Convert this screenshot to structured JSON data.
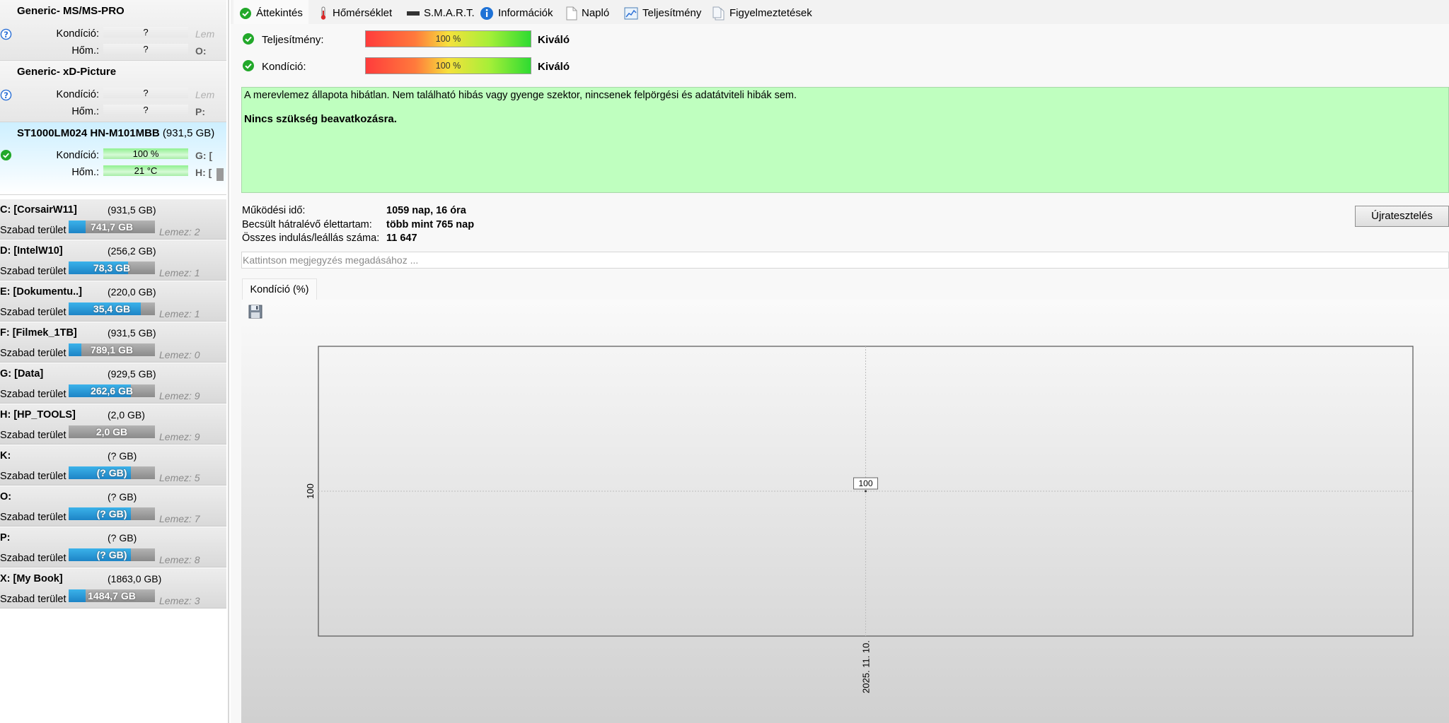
{
  "disks": [
    {
      "name": "Generic- MS/MS-PRO",
      "size": "",
      "kondicio_label": "Kondíció:",
      "kondicio": "?",
      "hom_label": "Hőm.:",
      "hom": "?",
      "side1": "Lem",
      "side2": "O:"
    },
    {
      "name": "Generic- xD-Picture",
      "size": "",
      "kondicio_label": "Kondíció:",
      "kondicio": "?",
      "hom_label": "Hőm.:",
      "hom": "?",
      "side1": "Lem",
      "side2": "P:"
    },
    {
      "name": "ST1000LM024 HN-M101MBB",
      "size": "(931,5 GB)",
      "kondicio_label": "Kondíció:",
      "kondicio": "100 %",
      "hom_label": "Hőm.:",
      "hom": "21 °C",
      "side1": "G: [",
      "side2": "H: ["
    }
  ],
  "partitions": [
    {
      "name": "C: [CorsairW11]",
      "size": "(931,5 GB)",
      "free_label": "Szabad terület",
      "free": "741,7 GB",
      "used_fraction": 0.2,
      "lemez": "Lemez: 2"
    },
    {
      "name": "D: [IntelW10]",
      "size": "(256,2 GB)",
      "free_label": "Szabad terület",
      "free": "78,3 GB",
      "used_fraction": 0.69,
      "lemez": "Lemez: 1"
    },
    {
      "name": "E: [Dokumentu..]",
      "size": "(220,0 GB)",
      "free_label": "Szabad terület",
      "free": "35,4 GB",
      "used_fraction": 0.84,
      "lemez": "Lemez: 1"
    },
    {
      "name": "F: [Filmek_1TB]",
      "size": "(931,5 GB)",
      "free_label": "Szabad terület",
      "free": "789,1 GB",
      "used_fraction": 0.15,
      "lemez": "Lemez: 0"
    },
    {
      "name": "G: [Data]",
      "size": "(929,5 GB)",
      "free_label": "Szabad terület",
      "free": "262,6 GB",
      "used_fraction": 0.72,
      "lemez": "Lemez: 9"
    },
    {
      "name": "H: [HP_TOOLS]",
      "size": "(2,0 GB)",
      "free_label": "Szabad terület",
      "free": "2,0 GB",
      "used_fraction": 0.0,
      "lemez": "Lemez: 9"
    },
    {
      "name": "K:",
      "size": "(? GB)",
      "free_label": "Szabad terület",
      "free": "(? GB)",
      "used_fraction": 0.72,
      "lemez": "Lemez: 5"
    },
    {
      "name": "O:",
      "size": "(? GB)",
      "free_label": "Szabad terület",
      "free": "(? GB)",
      "used_fraction": 0.72,
      "lemez": "Lemez: 7"
    },
    {
      "name": "P:",
      "size": "(? GB)",
      "free_label": "Szabad terület",
      "free": "(? GB)",
      "used_fraction": 0.72,
      "lemez": "Lemez: 8"
    },
    {
      "name": "X: [My Book]",
      "size": "(1863,0 GB)",
      "free_label": "Szabad terület",
      "free": "1484,7 GB",
      "used_fraction": 0.2,
      "lemez": "Lemez: 3"
    }
  ],
  "tabs": [
    {
      "label": "Áttekintés",
      "icon": "check-icon",
      "active": true
    },
    {
      "label": "Hőmérséklet",
      "icon": "thermometer-icon"
    },
    {
      "label": "S.M.A.R.T.",
      "icon": "drive-icon"
    },
    {
      "label": "Információk",
      "icon": "info-icon"
    },
    {
      "label": "Napló",
      "icon": "document-icon"
    },
    {
      "label": "Teljesítmény",
      "icon": "performance-chart-icon"
    },
    {
      "label": "Figyelmeztetések",
      "icon": "alerts-icon"
    }
  ],
  "overview": {
    "performance_label": "Teljesítmény:",
    "performance_value": "100 %",
    "performance_rating": "Kiváló",
    "condition_label": "Kondíció:",
    "condition_value": "100 %",
    "condition_rating": "Kiváló",
    "message": "A merevlemez állapota hibátlan. Nem található hibás vagy gyenge szektor, nincsenek felpörgési és adatátviteli hibák sem.",
    "advice": "Nincs szükség beavatkozásra.",
    "uptime_label": "Működési idő:",
    "uptime": "1059 nap, 16 óra",
    "lifetime_label": "Becsült hátralévő élettartam:",
    "lifetime": "több mint 765 nap",
    "startstop_label": "Összes indulás/leállás száma:",
    "startstop": "11 647",
    "retest_button": "Újratesztelés",
    "note_placeholder": "Kattintson megjegyzés megadásához ..."
  },
  "chart_tab_label": "Kondíció  (%)",
  "colors": {
    "ok_green": "#22a82a",
    "message_bg": "#bfffbf",
    "bar_blue": "#1d84c6",
    "selected_disk_bg": "#cdefff"
  },
  "chart_data": {
    "type": "line",
    "title": "",
    "xlabel": "",
    "ylabel": "",
    "x": [
      "2025. 11. 10."
    ],
    "series": [
      {
        "values": [
          100
        ]
      }
    ],
    "y_ticks": [
      100
    ],
    "ylim": [
      0,
      200
    ],
    "data_labels": [
      "100"
    ],
    "grid": true
  }
}
